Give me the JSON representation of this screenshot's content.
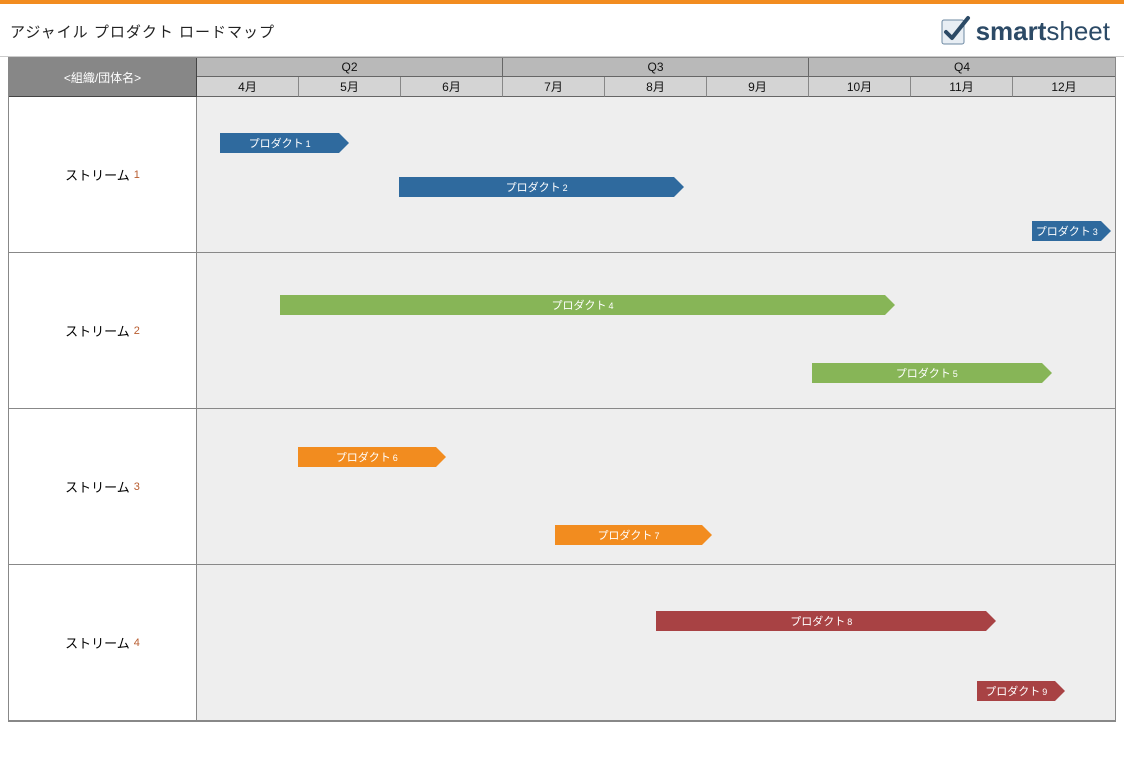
{
  "header": {
    "title": "アジャイル プロダクト ロードマップ",
    "logo_prefix": "smart",
    "logo_suffix": "sheet"
  },
  "corner_label": "<組織/団体名>",
  "quarters": [
    "Q2",
    "Q3",
    "Q4"
  ],
  "months": [
    "4月",
    "5月",
    "6月",
    "7月",
    "8月",
    "9月",
    "10月",
    "11月",
    "12月"
  ],
  "streams": [
    {
      "label": "ストリーム",
      "num": "1"
    },
    {
      "label": "ストリーム",
      "num": "2"
    },
    {
      "label": "ストリーム",
      "num": "3"
    },
    {
      "label": "ストリーム",
      "num": "4"
    }
  ],
  "products": {
    "p1": {
      "label": "プロダクト",
      "num": "1"
    },
    "p2": {
      "label": "プロダクト",
      "num": "2"
    },
    "p3": {
      "label": "プロダクト",
      "num": "3"
    },
    "p4": {
      "label": "プロダクト",
      "num": "4"
    },
    "p5": {
      "label": "プロダクト",
      "num": "5"
    },
    "p6": {
      "label": "プロダクト",
      "num": "6"
    },
    "p7": {
      "label": "プロダクト",
      "num": "7"
    },
    "p8": {
      "label": "プロダクト",
      "num": "8"
    },
    "p9": {
      "label": "プロダクト",
      "num": "9"
    }
  },
  "chart_data": {
    "type": "bar",
    "title": "アジャイル プロダクト ロードマップ",
    "xlabel": "月",
    "ylabel": "ストリーム",
    "x_categories": [
      "4月",
      "5月",
      "6月",
      "7月",
      "8月",
      "9月",
      "10月",
      "11月",
      "12月"
    ],
    "x_range_months": [
      4,
      12
    ],
    "streams": [
      {
        "name": "ストリーム 1",
        "color": "#2f6a9e",
        "bars": [
          {
            "name": "プロダクト 1",
            "start_month": 4.2,
            "end_month": 5.5
          },
          {
            "name": "プロダクト 2",
            "start_month": 6.0,
            "end_month": 8.8
          },
          {
            "name": "プロダクト 3",
            "start_month": 12.2,
            "end_month": 13.0
          }
        ]
      },
      {
        "name": "ストリーム 2",
        "color": "#87b557",
        "bars": [
          {
            "name": "プロダクト 4",
            "start_month": 4.8,
            "end_month": 10.8
          },
          {
            "name": "プロダクト 5",
            "start_month": 10.0,
            "end_month": 12.3
          }
        ]
      },
      {
        "name": "ストリーム 3",
        "color": "#f28c1f",
        "bars": [
          {
            "name": "プロダクト 6",
            "start_month": 5.0,
            "end_month": 6.4
          },
          {
            "name": "プロダクト 7",
            "start_month": 7.5,
            "end_month": 9.0
          }
        ]
      },
      {
        "name": "ストリーム 4",
        "color": "#a84244",
        "bars": [
          {
            "name": "プロダクト 8",
            "start_month": 8.5,
            "end_month": 11.8
          },
          {
            "name": "プロダクト 9",
            "start_month": 11.6,
            "end_month": 12.4
          }
        ]
      }
    ]
  }
}
